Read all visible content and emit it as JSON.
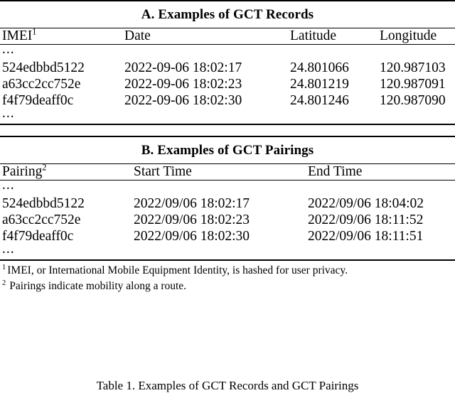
{
  "document": {
    "caption": "Table 1. Examples of GCT Records and GCT Pairings"
  },
  "section_a": {
    "title": "A. Examples of GCT Records",
    "columns": [
      "IMEI",
      "Date",
      "Latitude",
      "Longitude"
    ],
    "column_header_imei_base": "IMEI",
    "column_header_imei_sup": "1",
    "column_header_date": "Date",
    "column_header_latitude": "Latitude",
    "column_header_longitude": "Longitude",
    "leading_ellipsis": "...",
    "trailing_ellipsis": "...",
    "rows": [
      {
        "imei": "524edbbd5122",
        "date": "2022-09-06 18:02:17",
        "latitude": "24.801066",
        "longitude": "120.987103"
      },
      {
        "imei": "a63cc2cc752e",
        "date": "2022-09-06 18:02:23",
        "latitude": "24.801219",
        "longitude": "120.987091"
      },
      {
        "imei": "f4f79deaff0c",
        "date": "2022-09-06 18:02:30",
        "latitude": "24.801246",
        "longitude": "120.987090"
      }
    ]
  },
  "section_b": {
    "title": "B. Examples of GCT Pairings",
    "columns": [
      "Pairing",
      "Start Time",
      "End Time"
    ],
    "column_header_pairing_base": "Pairing",
    "column_header_pairing_sup": "2",
    "column_header_start_time": "Start Time",
    "column_header_end_time": "End Time",
    "leading_ellipsis": "...",
    "trailing_ellipsis": "...",
    "rows": [
      {
        "pairing": "524edbbd5122",
        "start_time": "2022/09/06 18:02:17",
        "end_time": "2022/09/06 18:04:02"
      },
      {
        "pairing": "a63cc2cc752e",
        "start_time": "2022/09/06 18:02:23",
        "end_time": "2022/09/06 18:11:52"
      },
      {
        "pairing": "f4f79deaff0c",
        "start_time": "2022/09/06 18:02:30",
        "end_time": "2022/09/06 18:11:51"
      }
    ]
  },
  "footnotes": [
    {
      "mark": "1",
      "text": "IMEI, or International Mobile Equipment Identity, is hashed for user privacy."
    },
    {
      "mark": "2",
      "text": "Pairings indicate mobility along a route."
    }
  ]
}
